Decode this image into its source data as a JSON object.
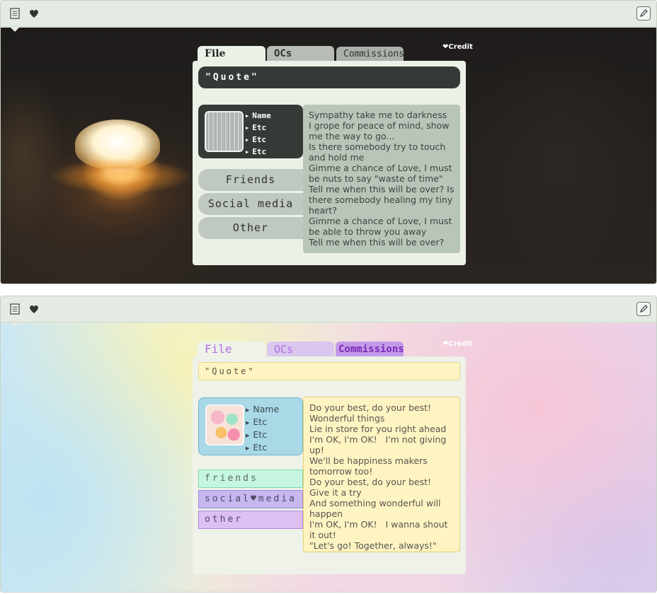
{
  "posts": [
    {
      "tabs": [
        "File",
        "OCs",
        "Commissions"
      ],
      "credit": "❤Credit",
      "quote": "\"Quote\"",
      "profile_fields": [
        "Name",
        "Etc",
        "Etc",
        "Etc"
      ],
      "nav": [
        "Friends",
        "Social media",
        "Other"
      ],
      "lyrics": "Sympathy take me to darkness\nI grope for peace of mind, show me the way to go...\nIs there somebody try to touch and hold me\nGimme a chance of Love, I must be nuts to say \"waste of time\"\nTell me when this will be over? Is there somebody healing my tiny heart?\nGimme a chance of Love, I must be able to throw you away\nTell me when this will be over?"
    },
    {
      "tabs": [
        "File",
        "OCs",
        "Commissions"
      ],
      "credit": "❤Credit",
      "quote": "\"Quote\"",
      "profile_fields": [
        "Name",
        "Etc",
        "Etc",
        "Etc"
      ],
      "nav": [
        "friends",
        "social♥media",
        "other"
      ],
      "lyrics": "Do your best, do your best!\nWonderful things\nLie in store for you right ahead\nI'm OK, I'm OK!   I'm not giving up!\nWe'll be happiness makers tomorrow too!\nDo your best, do your best! Give it a try\nAnd something wonderful will happen\nI'm OK, I'm OK!   I wanna shout it out!\n\"Let's go! Together, always!\""
    }
  ],
  "icons": {
    "toolbar_left": [
      "document-icon",
      "heart-icon"
    ],
    "toolbar_right": "pencil-icon"
  },
  "colors": {
    "panel_bg": "#e4ebe2",
    "dark_accent": "#343a36",
    "dark_lyrics_bg": "#b8c5b8",
    "pastel_yellow": "#fdf4c2",
    "pastel_blue": "#a9d8e6",
    "pastel_mint": "#c6f6e0",
    "pastel_lavender": "#c8b8f0",
    "pastel_purple": "#8a3ec8"
  }
}
